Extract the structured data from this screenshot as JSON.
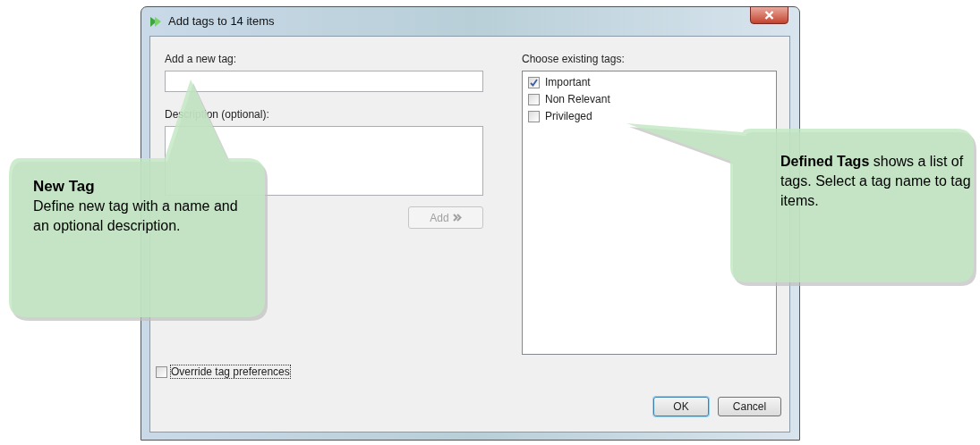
{
  "window": {
    "title": "Add tags to 14 items"
  },
  "new_tag": {
    "label": "Add a new tag:",
    "description_label": "Description (optional):",
    "add_button": {
      "label": "Add",
      "disabled": true
    }
  },
  "existing_tags": {
    "label": "Choose existing tags:",
    "items": [
      {
        "label": "Important",
        "checked": true
      },
      {
        "label": "Non Relevant",
        "checked": false
      },
      {
        "label": "Privileged",
        "checked": false
      }
    ]
  },
  "override": {
    "label": "Override tag preferences",
    "checked": false
  },
  "buttons": [
    {
      "label": "OK",
      "kind": "default"
    },
    {
      "label": "Cancel",
      "kind": "normal"
    }
  ],
  "callouts": [
    {
      "kind": "left",
      "heading": "New Tag",
      "text": "Define new tag with a name and an optional description."
    },
    {
      "kind": "right",
      "text": "**Defined Tags** shows a list of tags. Select a tag name to tag items."
    }
  ]
}
